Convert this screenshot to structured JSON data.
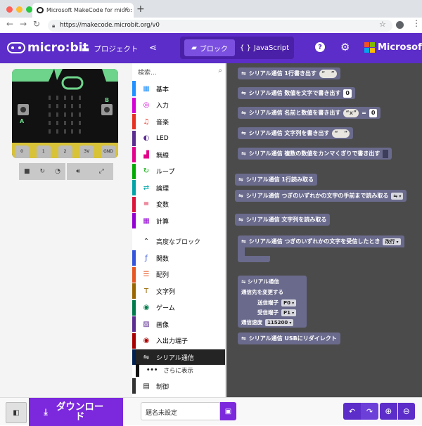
{
  "browser": {
    "tab_title": "Microsoft MakeCode for micro:",
    "url": "https://makecode.microbit.org/v0"
  },
  "header": {
    "brand": "micro:bit",
    "project_label": "プロジェクト",
    "blocks_label": "ブロック",
    "javascript_label": "JavaScript",
    "microsoft_label": "Microsoft"
  },
  "toolbox": {
    "search_placeholder": "検索...",
    "categories": [
      {
        "label": "基本",
        "color": "#1e90ff",
        "icon": "grid-icon"
      },
      {
        "label": "入力",
        "color": "#d400d4",
        "icon": "target-icon"
      },
      {
        "label": "音楽",
        "color": "#e63022",
        "icon": "headphones-icon"
      },
      {
        "label": "LED",
        "color": "#5c2d91",
        "icon": "toggle-icon"
      },
      {
        "label": "無線",
        "color": "#e3008c",
        "icon": "signal-icon"
      },
      {
        "label": "ループ",
        "color": "#00aa00",
        "icon": "loop-icon"
      },
      {
        "label": "論理",
        "color": "#00a4a6",
        "icon": "shuffle-icon"
      },
      {
        "label": "変数",
        "color": "#dc143c",
        "icon": "list-icon"
      },
      {
        "label": "計算",
        "color": "#9400d3",
        "icon": "calculator-icon"
      }
    ],
    "advanced_label": "高度なブロック",
    "advanced": [
      {
        "label": "関数",
        "color": "#3455db",
        "icon": "function-icon"
      },
      {
        "label": "配列",
        "color": "#e65722",
        "icon": "array-icon"
      },
      {
        "label": "文字列",
        "color": "#996600",
        "icon": "text-icon"
      },
      {
        "label": "ゲーム",
        "color": "#007a4b",
        "icon": "gamepad-icon"
      },
      {
        "label": "画像",
        "color": "#5c2d91",
        "icon": "image-icon"
      },
      {
        "label": "入出力端子",
        "color": "#a80000",
        "icon": "pins-icon"
      },
      {
        "label": "シリアル通信",
        "color": "#002050",
        "icon": "usb-icon"
      }
    ],
    "more_label": "さらに表示",
    "control_label": "制御"
  },
  "blocks": {
    "write_line": "シリアル通信 1行書き出す",
    "write_number": "シリアル通信 数値を文字で書き出す",
    "write_value": "シリアル通信 名前と数値を書き出す",
    "write_string": "シリアル通信 文字列を書き出す",
    "write_numbers": "シリアル通信 複数の数値をカンマくぎりで書き出す",
    "read_line": "シリアル通信 1行読み取る",
    "read_until": "シリアル通信 つぎのいずれかの文字の手前まで読み取る",
    "read_string": "シリアル通信 文字列を読み取る",
    "on_received": "シリアル通信 つぎのいずれかの文字を受信したとき",
    "on_received_value": "改行",
    "redirect_title": "シリアル通信",
    "redirect_sub": "通信先を変更する",
    "tx_label": "送信端子",
    "tx_value": "P0",
    "rx_label": "受信端子",
    "rx_value": "P1",
    "baud_label": "通信速度",
    "baud_value": "115200",
    "redirect_usb": "シリアル通信 USBにリダイレクト",
    "number_zero": "0",
    "name_x": "x",
    "equals": "=",
    "quote_left": "“",
    "quote_right": "”"
  },
  "footer": {
    "download_label": "ダウンロード",
    "project_name": "題名未設定"
  },
  "board": {
    "pin_labels": [
      "0",
      "1",
      "2",
      "3V",
      "GND"
    ],
    "button_a": "A",
    "button_b": "B"
  }
}
